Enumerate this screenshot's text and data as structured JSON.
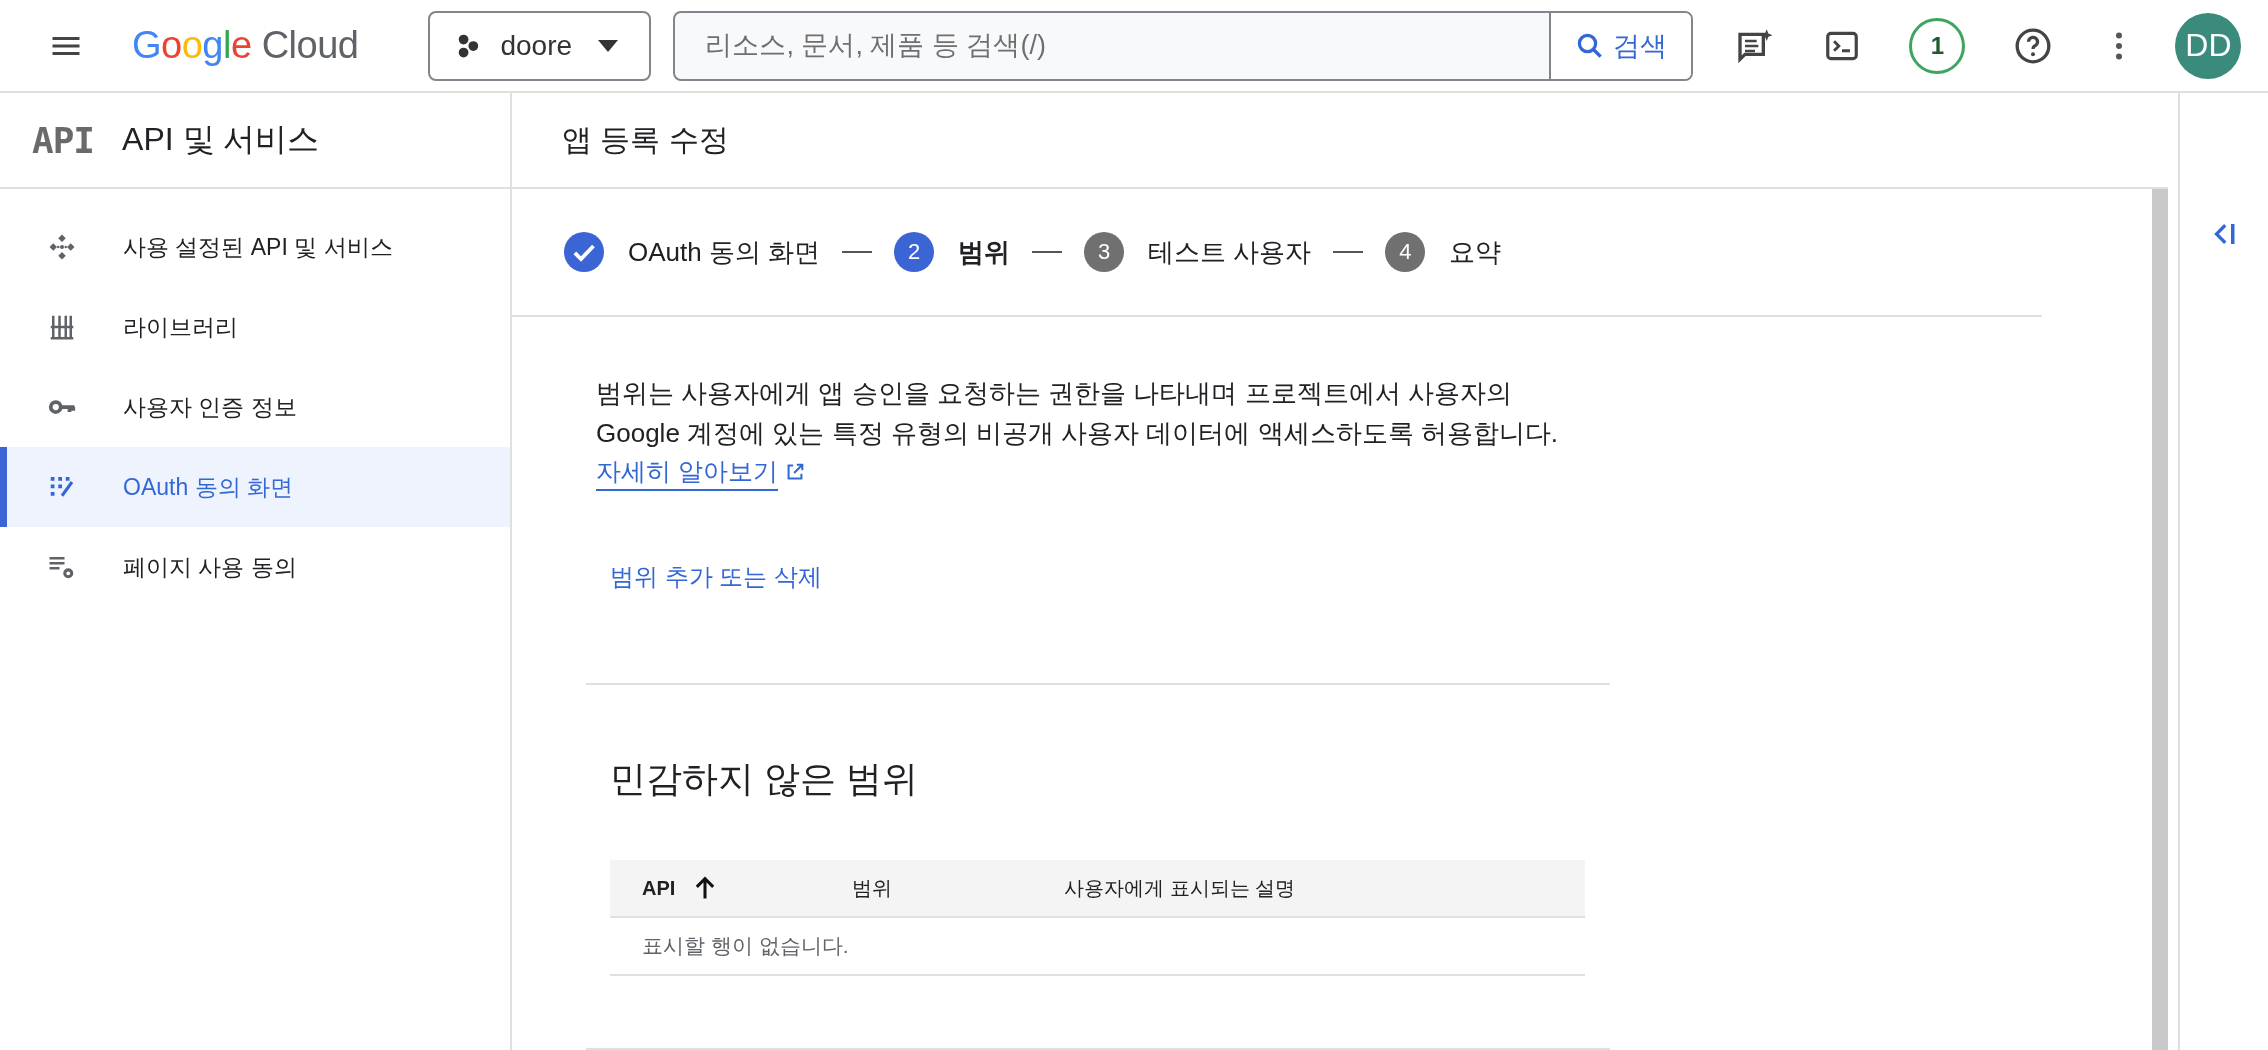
{
  "header": {
    "app_name": "Google Cloud",
    "project": "doore",
    "search": {
      "placeholder": "리소스, 문서, 제품 등 검색(/)",
      "button": "검색"
    },
    "notification_count": "1",
    "avatar": "DD"
  },
  "sidebar": {
    "logo": "API",
    "title": "API 및 서비스",
    "items": [
      {
        "label": "사용 설정된 API 및 서비스",
        "selected": false
      },
      {
        "label": "라이브러리",
        "selected": false
      },
      {
        "label": "사용자 인증 정보",
        "selected": false
      },
      {
        "label": "OAuth 동의 화면",
        "selected": true
      },
      {
        "label": "페이지 사용 동의",
        "selected": false
      }
    ]
  },
  "page_title": "앱 등록 수정",
  "stepper": [
    {
      "label": "OAuth 동의 화면",
      "completed": true,
      "selected": false
    },
    {
      "number": "2",
      "label": "범위",
      "completed": false,
      "selected": true
    },
    {
      "number": "3",
      "label": "테스트 사용자",
      "completed": false,
      "selected": false
    },
    {
      "number": "4",
      "label": "요약",
      "completed": false,
      "selected": false
    }
  ],
  "description": "범위는 사용자에게 앱 승인을 요청하는 권한을 나타내며 프로젝트에서 사용자의 Google 계정에 있는 특정 유형의 비공개 사용자 데이터에 액세스하도록 허용합니다.",
  "learn_more": "자세히 알아보기",
  "action_button": "범위 추가 또는 삭제",
  "section": {
    "title": "민감하지 않은 범위",
    "table": {
      "columns": [
        {
          "label": "API",
          "sorted_ascending": true
        },
        {
          "label": "범위"
        },
        {
          "label": "사용자에게 표시되는 설명"
        }
      ],
      "empty_message": "표시할 행이 없습니다."
    }
  }
}
